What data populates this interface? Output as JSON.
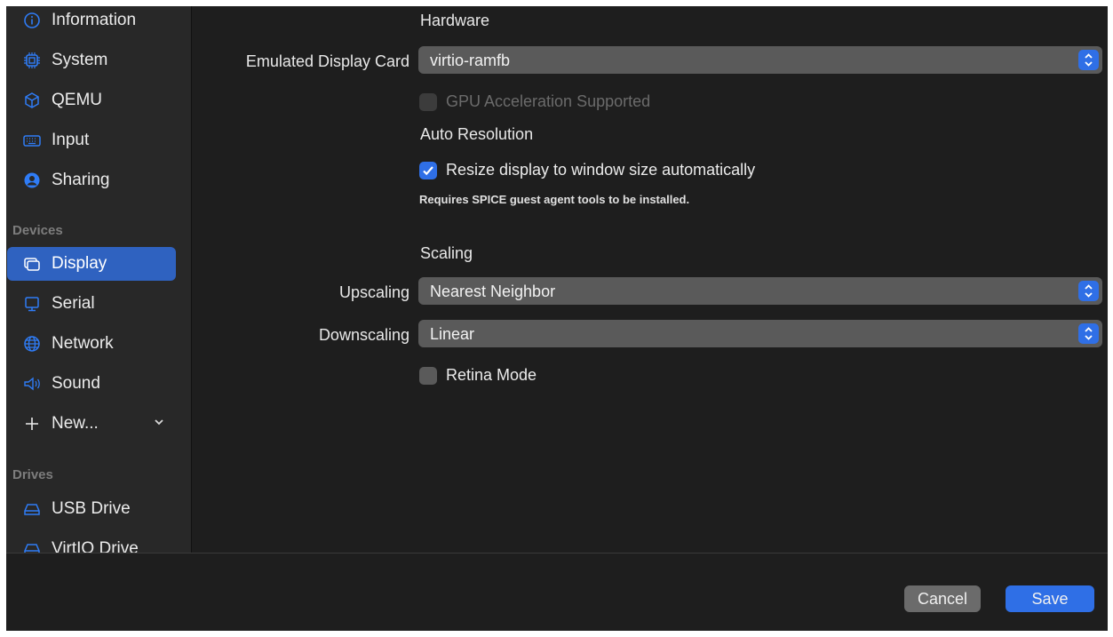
{
  "sidebar": {
    "items": [
      {
        "label": "Information",
        "icon": "info-icon"
      },
      {
        "label": "System",
        "icon": "chip-icon"
      },
      {
        "label": "QEMU",
        "icon": "cube-icon"
      },
      {
        "label": "Input",
        "icon": "keyboard-icon"
      },
      {
        "label": "Sharing",
        "icon": "person-circle-icon"
      }
    ],
    "devices_header": "Devices",
    "devices": [
      {
        "label": "Display",
        "icon": "display-icon",
        "selected": true
      },
      {
        "label": "Serial",
        "icon": "terminal-icon"
      },
      {
        "label": "Network",
        "icon": "globe-icon"
      },
      {
        "label": "Sound",
        "icon": "speaker-icon"
      },
      {
        "label": "New...",
        "icon": "plus-icon"
      }
    ],
    "drives_header": "Drives",
    "drives": [
      {
        "label": "USB Drive",
        "icon": "drive-icon"
      },
      {
        "label": "VirtIO Drive",
        "icon": "drive-icon"
      }
    ]
  },
  "main": {
    "hardware_title": "Hardware",
    "emulated_display_label": "Emulated Display Card",
    "emulated_display_value": "virtio-ramfb",
    "gpu_accel_label": "GPU Acceleration Supported",
    "auto_resolution_title": "Auto Resolution",
    "resize_label": "Resize display to window size automatically",
    "resize_checked": true,
    "spice_note": "Requires SPICE guest agent tools to be installed.",
    "scaling_title": "Scaling",
    "upscaling_label": "Upscaling",
    "upscaling_value": "Nearest Neighbor",
    "downscaling_label": "Downscaling",
    "downscaling_value": "Linear",
    "retina_label": "Retina Mode",
    "retina_checked": false
  },
  "footer": {
    "cancel_label": "Cancel",
    "save_label": "Save"
  },
  "colors": {
    "accent": "#2f6fe6",
    "selection": "#2f62c0",
    "background": "#1e1e1e",
    "sidebar": "#282828"
  }
}
